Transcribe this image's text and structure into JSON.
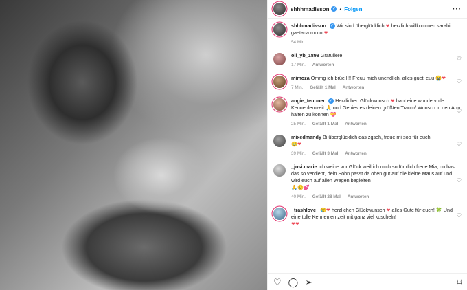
{
  "header": {
    "username": "shhhmadisson",
    "follow_label": "Folgen",
    "more_label": "···"
  },
  "caption": {
    "username": "shhhmadisson",
    "text_a": "Wir sind überglücklich",
    "text_b": "herzlich willkommen sarabi gaetana rocco",
    "time": "54 Min."
  },
  "comments": [
    {
      "username": "oli_yb_1898",
      "text": "Gratuliere",
      "time": "17 Min.",
      "likes": "",
      "reply": "Antworten"
    },
    {
      "username": "mimoza",
      "text": "Ommg ich brüell !! Freuu mich unendlich. alles gueti euu",
      "time": "7 Min.",
      "likes": "Gefällt 1 Mal",
      "reply": "Antworten"
    },
    {
      "username": "angie_teubner",
      "text_a": "Herzlichen Glückwunsch",
      "text_b": "habt eine wundervolle Kennenlernzeit",
      "text_c": "und Genies es deinen größten Traum/ Wunsch in den Arm halten zu können",
      "time": "25 Min.",
      "likes": "Gefällt 1 Mal",
      "reply": "Antworten"
    },
    {
      "username": "mixedmandy",
      "text": "Bi überglücklich das zgseh, freue mi soo für euch",
      "time": "39 Min.",
      "likes": "Gefällt 3 Mal",
      "reply": "Antworten"
    },
    {
      "username": "_josi.marie",
      "text": "Ich weine vor Glück weil ich mich so für dich freue Mia, du hast das so verdient, dein Sohn passt da oben gut auf die kleine Maus auf und wird euch auf allen Wegen begleiten",
      "time": "40 Min.",
      "likes": "Gefällt 28 Mal",
      "reply": "Antworten"
    },
    {
      "username": "_trashlove_",
      "text_a": "herzlichen Glückwunsch",
      "text_b": "alles Gute für euch!",
      "text_c": "Und eine tolle Kennenlernzeit mit ganz viel kuscheln!",
      "time": "",
      "likes": "",
      "reply": ""
    }
  ],
  "icons": {
    "heart": "♡",
    "red_heart": "❤",
    "comment": "◯",
    "share": "➢",
    "save": "⌑"
  },
  "colors": {
    "accent": "#0095f6",
    "verified": "#3897f0",
    "like_red": "#ed4956"
  }
}
